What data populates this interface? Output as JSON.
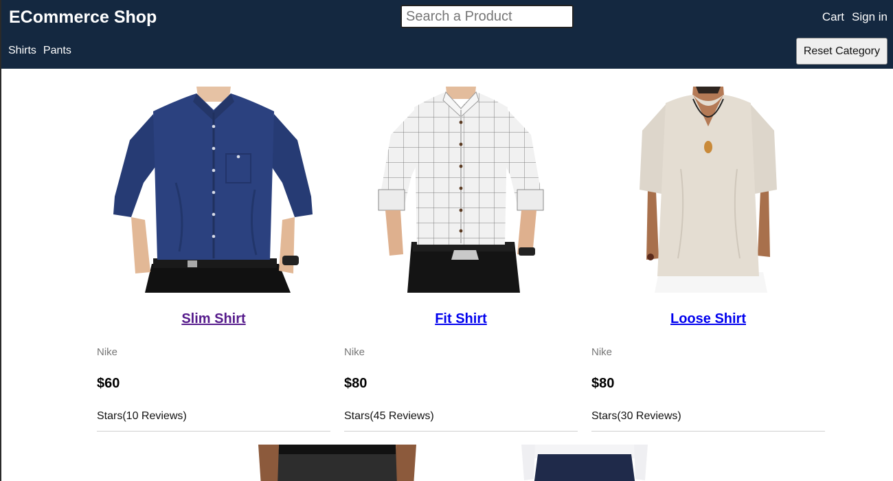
{
  "header": {
    "brand": "ECommerce Shop",
    "search_placeholder": "Search a Product",
    "cart_label": "Cart",
    "signin_label": "Sign in",
    "categories": [
      "Shirts",
      "Pants"
    ],
    "reset_label": "Reset Category"
  },
  "colors": {
    "header_bg": "#142840",
    "link": "#0000ee",
    "visited_link": "#551a8b"
  },
  "products": [
    {
      "name": "Slim Shirt",
      "brand": "Nike",
      "price": "$60",
      "rating": "Stars(10 Reviews)",
      "image_icon": "navy-shirt-photo"
    },
    {
      "name": "Fit Shirt",
      "brand": "Nike",
      "price": "$80",
      "rating": "Stars(45 Reviews)",
      "image_icon": "plaid-shirt-photo"
    },
    {
      "name": "Loose Shirt",
      "brand": "Nike",
      "price": "$80",
      "rating": "Stars(30 Reviews)",
      "image_icon": "linen-shirt-photo"
    }
  ]
}
